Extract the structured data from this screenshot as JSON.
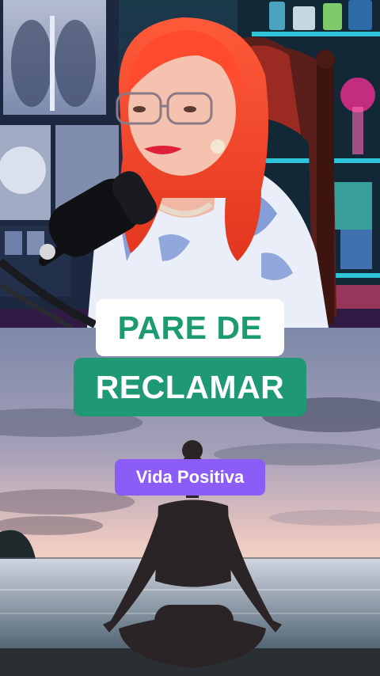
{
  "captions": {
    "line1": "PARE DE",
    "line2": "RECLAMAR"
  },
  "tag": {
    "label": "Vida Positiva"
  },
  "colors": {
    "caption_line1_bg": "#ffffff",
    "caption_line1_text": "#1c9a72",
    "caption_line2_bg": "#1f9874",
    "caption_line2_text": "#ffffff",
    "tag_bg": "#8b5cf6",
    "tag_text": "#ffffff"
  }
}
